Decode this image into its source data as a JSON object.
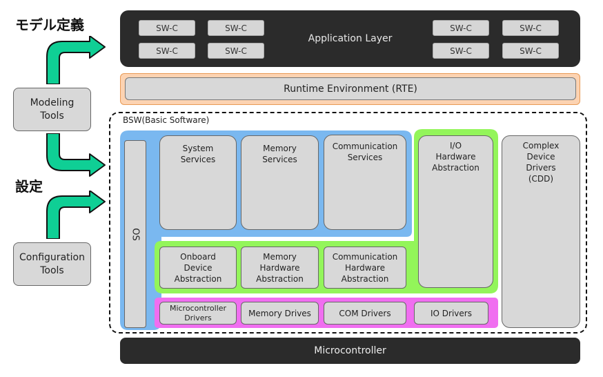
{
  "labels": {
    "model_definition": "モデル定義",
    "configuration": "設定"
  },
  "tools": {
    "modeling_line1": "Modeling",
    "modeling_line2": "Tools",
    "configuration_line1": "Configuration",
    "configuration_line2": "Tools"
  },
  "application_layer": {
    "label": "Application Layer",
    "swc": [
      "SW-C",
      "SW-C",
      "SW-C",
      "SW-C",
      "SW-C",
      "SW-C",
      "SW-C",
      "SW-C"
    ]
  },
  "rte": {
    "label": "Runtime Environment (RTE)"
  },
  "bsw": {
    "title": "BSW(Basic Software)",
    "os": "OS",
    "services": {
      "system_l1": "System",
      "system_l2": "Services",
      "memory_l1": "Memory",
      "memory_l2": "Services",
      "comm_l1": "Communication",
      "comm_l2": "Services"
    },
    "abstraction": {
      "onboard_l1": "Onboard",
      "onboard_l2": "Device",
      "onboard_l3": "Abstraction",
      "memory_l1": "Memory",
      "memory_l2": "Hardware",
      "memory_l3": "Abstraction",
      "comm_l1": "Communication",
      "comm_l2": "Hardware",
      "comm_l3": "Abstraction",
      "io_l1": "I/O",
      "io_l2": "Hardware",
      "io_l3": "Abstraction"
    },
    "drivers": {
      "micro_l1": "Microcontroller",
      "micro_l2": "Drivers",
      "memory": "Memory Drives",
      "com": "COM Drivers",
      "io": "IO Drivers"
    },
    "cdd": {
      "l1": "Complex",
      "l2": "Device",
      "l3": "Drivers",
      "l4": "(CDD)"
    }
  },
  "microcontroller": {
    "label": "Microcontroller"
  },
  "colors": {
    "dark_layer": "#2b2b2b",
    "rte_fill": "#fcd3b2",
    "rte_border": "#e89a55",
    "bsw_blue": "#7ab8f0",
    "bsw_green": "#93f55a",
    "bsw_magenta": "#f06ef0",
    "module_gray": "#d8d8d8",
    "arrow_green": "#0fcf95"
  },
  "icons": {
    "arrow": "curved-arrow-right-icon"
  }
}
